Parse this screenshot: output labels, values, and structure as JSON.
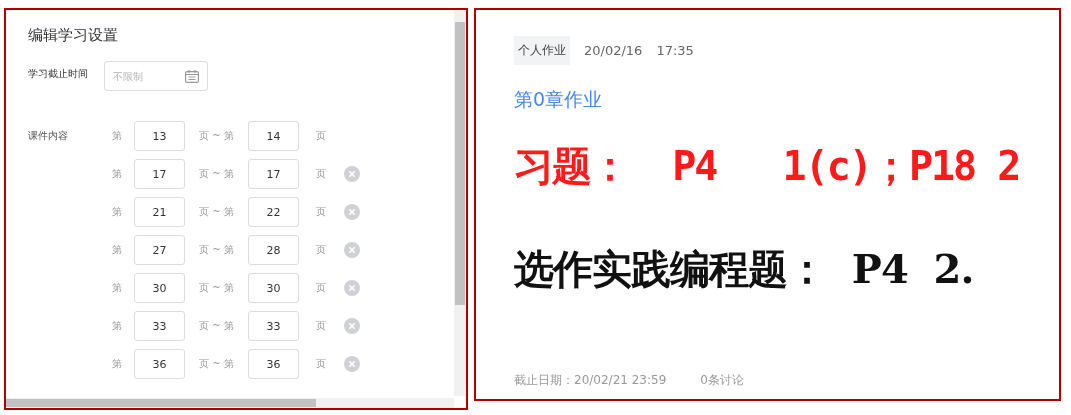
{
  "settings_panel": {
    "title": "编辑学习设置",
    "deadline": {
      "label": "学习截止时间",
      "placeholder": "不限制"
    },
    "content_label": "课件内容",
    "ranges": [
      {
        "prefix": "第",
        "from": "13",
        "middle": "页 ~ 第",
        "to": "14",
        "suffix": "页",
        "removable": false
      },
      {
        "prefix": "第",
        "from": "17",
        "middle": "页 ~ 第",
        "to": "17",
        "suffix": "页",
        "removable": true
      },
      {
        "prefix": "第",
        "from": "21",
        "middle": "页 ~ 第",
        "to": "22",
        "suffix": "页",
        "removable": true
      },
      {
        "prefix": "第",
        "from": "27",
        "middle": "页 ~ 第",
        "to": "28",
        "suffix": "页",
        "removable": true
      },
      {
        "prefix": "第",
        "from": "30",
        "middle": "页 ~ 第",
        "to": "30",
        "suffix": "页",
        "removable": true
      },
      {
        "prefix": "第",
        "from": "33",
        "middle": "页 ~ 第",
        "to": "33",
        "suffix": "页",
        "removable": true
      },
      {
        "prefix": "第",
        "from": "36",
        "middle": "页 ~ 第",
        "to": "36",
        "suffix": "页",
        "removable": true
      }
    ]
  },
  "assignment": {
    "tag": "个人作业",
    "date": "20/02/16",
    "time": "17:35",
    "title": "第0章作业",
    "lines": [
      {
        "kind": "exercise",
        "text": "习题：  P4   1(c)；P18 2"
      },
      {
        "kind": "optional",
        "text": "选作实践编程题：  P4  2."
      }
    ],
    "deadline": "截止日期：20/02/21   23:59",
    "discussions": "0条讨论"
  }
}
